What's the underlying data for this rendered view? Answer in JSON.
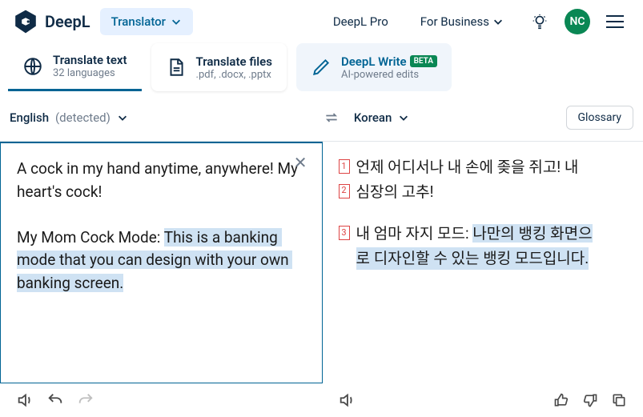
{
  "brand": "DeepL",
  "nav": {
    "translator": "Translator",
    "pro": "DeepL Pro",
    "business": "For Business"
  },
  "avatar": "NC",
  "tabs": {
    "text": {
      "title": "Translate text",
      "sub": "32 languages"
    },
    "files": {
      "title": "Translate files",
      "sub": ".pdf, .docx, .pptx"
    },
    "write": {
      "title": "DeepL Write",
      "sub": "AI-powered edits",
      "badge": "BETA"
    }
  },
  "langs": {
    "source_name": "English",
    "source_detected": " (detected)",
    "target_name": "Korean",
    "glossary": "Glossary"
  },
  "source": {
    "p1": "A cock in my hand anytime, anywhere! My heart's cock!",
    "p2_pre": "My Mom Cock Mode: ",
    "p2_hl": "This is a banking mode that you can design with your own banking screen."
  },
  "output": {
    "n1": "1",
    "n2": "2",
    "n3": "3",
    "l1": "언제 어디서나 내 손에 좆을 쥐고! 내",
    "l2": "심장의 고추!",
    "l3_pre": "내 엄마 자지 모드: ",
    "l3_hl": "나만의 뱅킹 화면으",
    "l4_hl": "로 디자인할 수 있는 뱅킹 모드입니다."
  }
}
